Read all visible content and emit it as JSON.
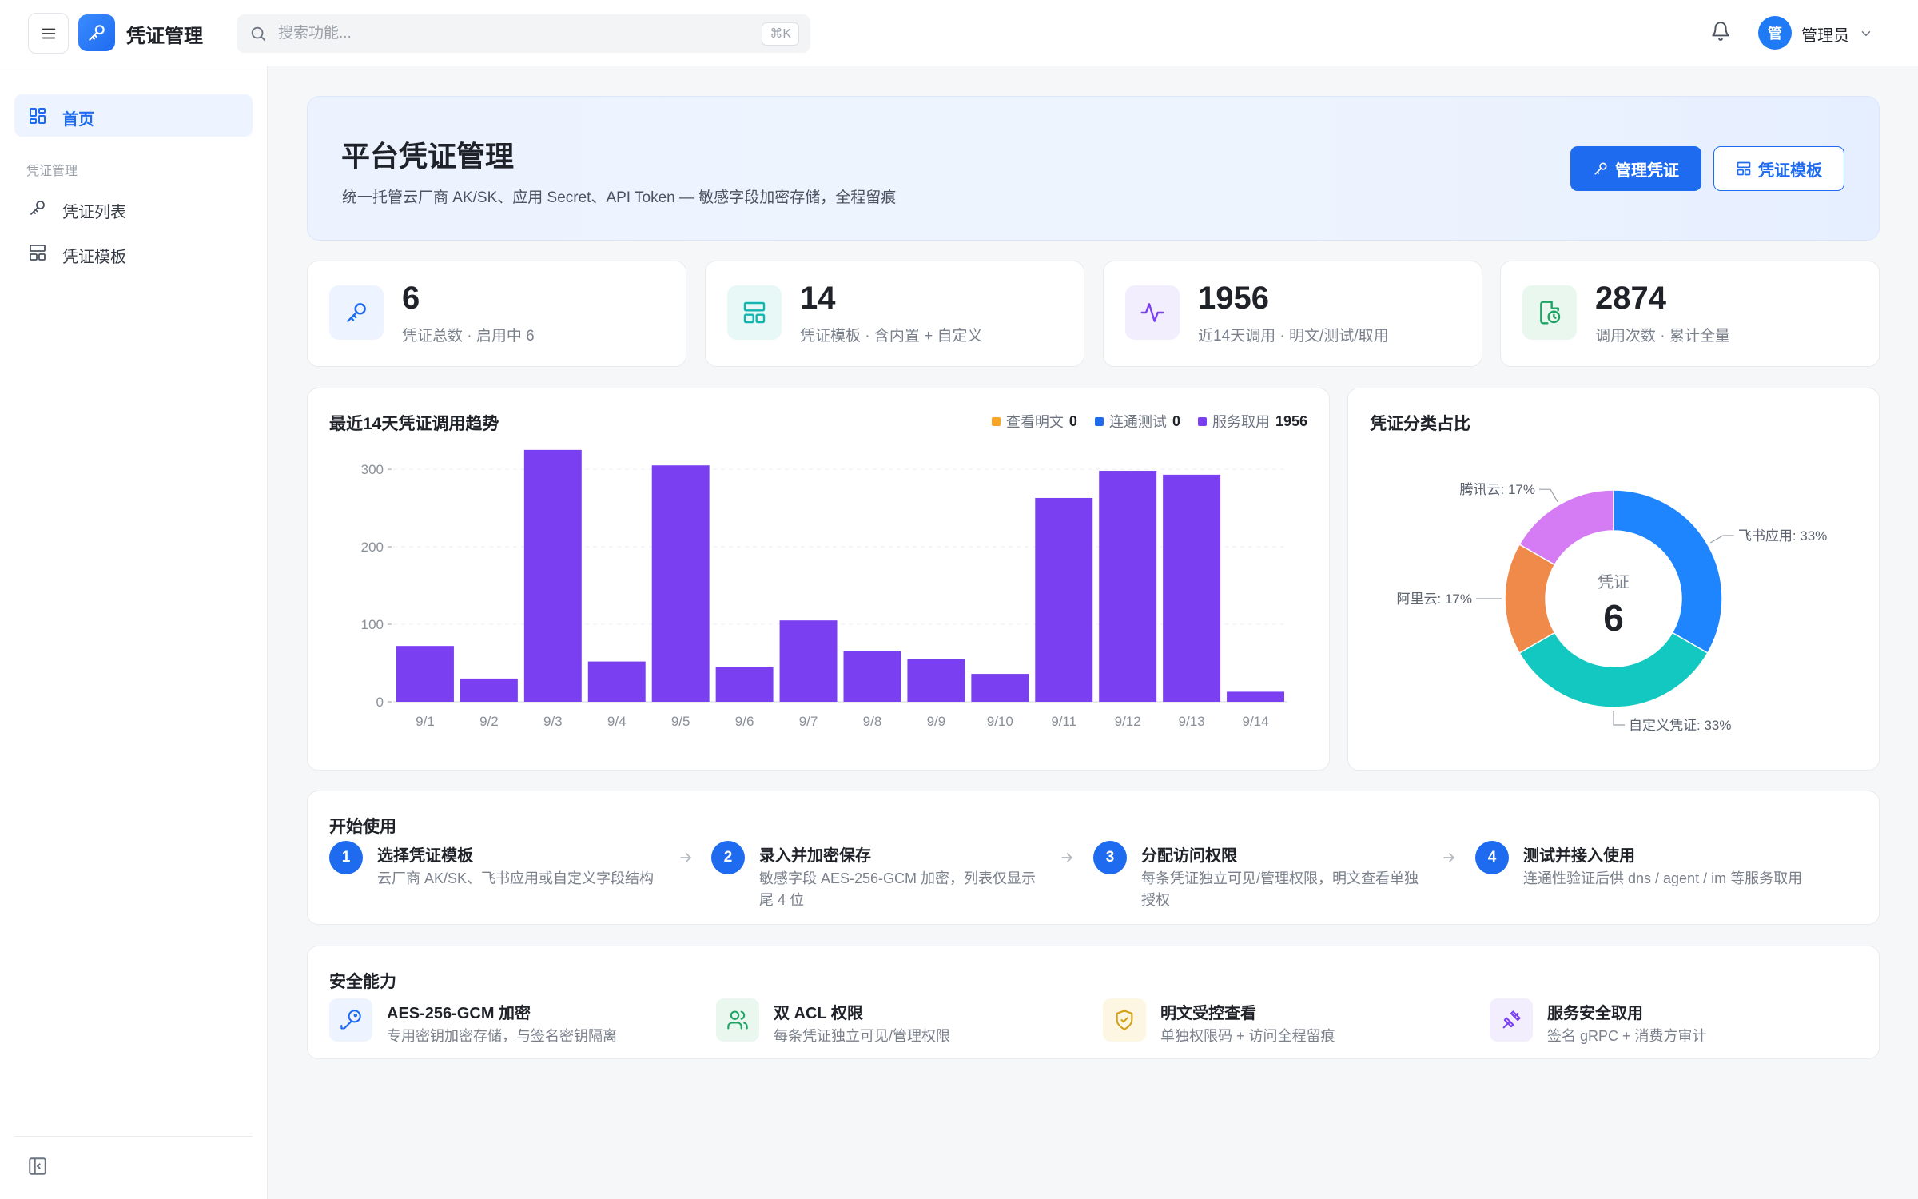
{
  "app": {
    "title": "凭证管理"
  },
  "search": {
    "placeholder": "搜索功能...",
    "shortcut": "⌘K"
  },
  "user": {
    "avatar_text": "管",
    "name": "管理员"
  },
  "sidebar": {
    "home_label": "首页",
    "group_label": "凭证管理",
    "items": [
      {
        "label": "凭证列表",
        "icon": "key-icon"
      },
      {
        "label": "凭证模板",
        "icon": "template-icon"
      }
    ]
  },
  "hero": {
    "title": "平台凭证管理",
    "subtitle": "统一托管云厂商 AK/SK、应用 Secret、API Token — 敏感字段加密存储，全程留痕",
    "primary_button": "管理凭证",
    "secondary_button": "凭证模板"
  },
  "stats": [
    {
      "value": "6",
      "label": "凭证总数 · 启用中 6",
      "icon": "key-icon",
      "color": "#1f6bf0",
      "bg": "#eef4ff"
    },
    {
      "value": "14",
      "label": "凭证模板 · 含内置 + 自定义",
      "icon": "template-icon",
      "color": "#12b5b0",
      "bg": "#e8f8f7"
    },
    {
      "value": "1956",
      "label": "近14天调用 · 明文/测试/取用",
      "icon": "activity-icon",
      "color": "#7a3ff0",
      "bg": "#f3eefe"
    },
    {
      "value": "2874",
      "label": "调用次数 · 累计全量",
      "icon": "file-clock-icon",
      "color": "#1fa463",
      "bg": "#e9f7ef"
    }
  ],
  "trend": {
    "title": "最近14天凭证调用趋势",
    "legend": [
      {
        "name": "查看明文",
        "total": "0",
        "color": "#f5a623"
      },
      {
        "name": "连通测试",
        "total": "0",
        "color": "#1f6bf0"
      },
      {
        "name": "服务取用",
        "total": "1956",
        "color": "#7a3ff0"
      }
    ]
  },
  "chart_data": [
    {
      "type": "bar",
      "title": "最近14天凭证调用趋势",
      "categories": [
        "9/1",
        "9/2",
        "9/3",
        "9/4",
        "9/5",
        "9/6",
        "9/7",
        "9/8",
        "9/9",
        "9/10",
        "9/11",
        "9/12",
        "9/13",
        "9/14"
      ],
      "series": [
        {
          "name": "查看明文",
          "values": [
            0,
            0,
            0,
            0,
            0,
            0,
            0,
            0,
            0,
            0,
            0,
            0,
            0,
            0
          ],
          "color": "#f5a623"
        },
        {
          "name": "连通测试",
          "values": [
            0,
            0,
            0,
            0,
            0,
            0,
            0,
            0,
            0,
            0,
            0,
            0,
            0,
            0
          ],
          "color": "#1f6bf0"
        },
        {
          "name": "服务取用",
          "values": [
            72,
            30,
            325,
            52,
            305,
            45,
            105,
            65,
            55,
            36,
            263,
            298,
            293,
            13
          ],
          "color": "#7a3ff0"
        }
      ],
      "ylim": [
        0,
        330
      ],
      "yticks": [
        0,
        100,
        200,
        300
      ],
      "grid": true,
      "legend_position": "top-right"
    },
    {
      "type": "pie",
      "title": "凭证分类占比",
      "center_label": "凭证",
      "center_value": "6",
      "slices": [
        {
          "name": "飞书应用",
          "value": 2,
          "label": "飞书应用: 33%",
          "color": "#1f85ff"
        },
        {
          "name": "自定义凭证",
          "value": 2,
          "label": "自定义凭证: 33%",
          "color": "#14c8c2"
        },
        {
          "name": "阿里云",
          "value": 1,
          "label": "阿里云: 17%",
          "color": "#f08a4b"
        },
        {
          "name": "腾讯云",
          "value": 1,
          "label": "腾讯云: 17%",
          "color": "#d57cf5"
        }
      ]
    }
  ],
  "start": {
    "title": "开始使用",
    "steps": [
      {
        "num": "1",
        "title": "选择凭证模板",
        "desc": "云厂商 AK/SK、飞书应用或自定义字段结构"
      },
      {
        "num": "2",
        "title": "录入并加密保存",
        "desc": "敏感字段 AES-256-GCM 加密，列表仅显示尾 4 位"
      },
      {
        "num": "3",
        "title": "分配访问权限",
        "desc": "每条凭证独立可见/管理权限，明文查看单独授权"
      },
      {
        "num": "4",
        "title": "测试并接入使用",
        "desc": "连通性验证后供 dns / agent / im 等服务取用"
      }
    ]
  },
  "security": {
    "title": "安全能力",
    "features": [
      {
        "title": "AES-256-GCM 加密",
        "desc": "专用密钥加密存储，与签名密钥隔离",
        "icon": "key-round-icon",
        "color": "#1f6bf0",
        "bg": "#eef4ff"
      },
      {
        "title": "双 ACL 权限",
        "desc": "每条凭证独立可见/管理权限",
        "icon": "users-icon",
        "color": "#1fa463",
        "bg": "#e9f7ef"
      },
      {
        "title": "明文受控查看",
        "desc": "单独权限码 + 访问全程留痕",
        "icon": "shield-check-icon",
        "color": "#d4a017",
        "bg": "#fdf6e3"
      },
      {
        "title": "服务安全取用",
        "desc": "签名 gRPC + 消费方审计",
        "icon": "plug-icon",
        "color": "#7a3ff0",
        "bg": "#f3eefe"
      }
    ]
  }
}
